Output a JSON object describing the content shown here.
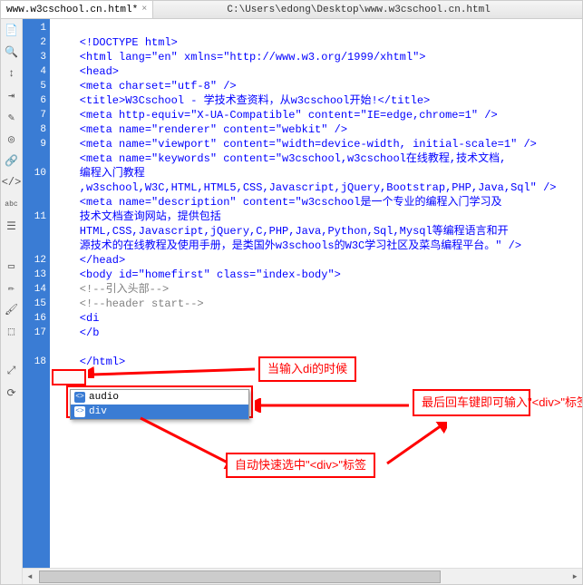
{
  "titlebar": {
    "tab_name": "www.w3cschool.cn.html*",
    "filepath": "C:\\Users\\edong\\Desktop\\www.w3cschool.cn.html"
  },
  "gutter_lines": [
    "1",
    "2",
    "3",
    "4",
    "5",
    "6",
    "7",
    "8",
    "9",
    "",
    "10",
    "",
    "",
    "11",
    "",
    "",
    "12",
    "13",
    "14",
    "15",
    "16",
    "17",
    "",
    "18"
  ],
  "code": {
    "l1": "<!DOCTYPE html>",
    "l2": "<html lang=\"en\" xmlns=\"http://www.w3.org/1999/xhtml\">",
    "l3": "<head>",
    "l4": "<meta charset=\"utf-8\" />",
    "l5": "<title>W3Cschool - 学技术查资料，从w3cschool开始!</title>",
    "l6": "<meta http-equiv=\"X-UA-Compatible\" content=\"IE=edge,chrome=1\" />",
    "l7": "<meta name=\"renderer\" content=\"webkit\" />",
    "l8": "<meta name=\"viewport\" content=\"width=device-width, initial-scale=1\" />",
    "l9a": "<meta name=\"keywords\" content=\"w3cschool,w3cschool在线教程,技术文档,",
    "l9b": "编程入门教程",
    "l9c": ",w3school,W3C,HTML,HTML5,CSS,Javascript,jQuery,Bootstrap,PHP,Java,Sql\" />",
    "l10a": "<meta name=\"description\" content=\"w3cschool是一个专业的编程入门学习及",
    "l10b": "技术文档查询网站，提供包括",
    "l10c": "HTML,CSS,Javascript,jQuery,C,PHP,Java,Python,Sql,Mysql等编程语言和开",
    "l10d": "源技术的在线教程及使用手册，是类国外w3schools的W3C学习社区及菜鸟编程平台。\" />",
    "l12": "</head>",
    "l13": "<body id=\"homefirst\" class=\"index-body\">",
    "l14": "<!--引入头部-->",
    "l15": "<!--header start-->",
    "l16": "<di",
    "l17": "</b",
    "l18": "</html>"
  },
  "autocomplete": {
    "items": [
      {
        "label": "audio",
        "selected": false
      },
      {
        "label": "div",
        "selected": true
      }
    ]
  },
  "annotations": {
    "a1": "当输入di的时候",
    "a2": "最后回车键即可输入\"<div>\"标签",
    "a3": "自动快速选中\"<div>\"标签"
  }
}
